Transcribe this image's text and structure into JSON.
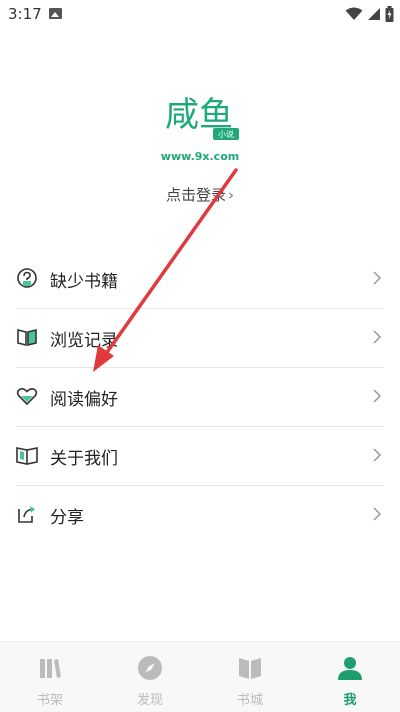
{
  "status_bar": {
    "time": "3:17"
  },
  "brand": {
    "logo_text": "咸鱼",
    "logo_sub": "小说",
    "url": "www.9x.com",
    "color": "#1fa87a"
  },
  "login": {
    "label": "点击登录",
    "chevron": "›"
  },
  "menu": {
    "items": [
      {
        "label": "缺少书籍",
        "icon": "question-book-icon"
      },
      {
        "label": "浏览记录",
        "icon": "open-book-icon"
      },
      {
        "label": "阅读偏好",
        "icon": "heart-icon"
      },
      {
        "label": "关于我们",
        "icon": "book-icon"
      },
      {
        "label": "分享",
        "icon": "share-icon"
      }
    ]
  },
  "bottom_nav": {
    "items": [
      {
        "label": "书架",
        "icon": "bookshelf-icon",
        "active": false
      },
      {
        "label": "发现",
        "icon": "compass-icon",
        "active": false
      },
      {
        "label": "书城",
        "icon": "bookstore-icon",
        "active": false
      },
      {
        "label": "我",
        "icon": "profile-icon",
        "active": true
      }
    ],
    "active_color": "#1e9e6e",
    "inactive_color": "#bbbbbb"
  },
  "annotation": {
    "color": "#e0393e"
  }
}
